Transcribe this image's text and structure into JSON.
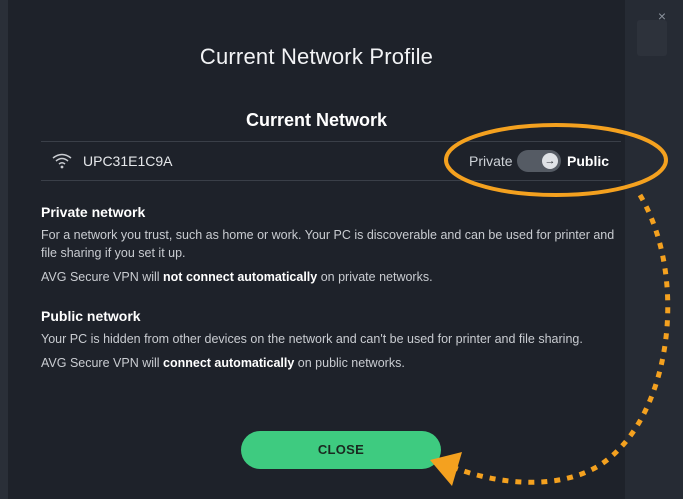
{
  "dialog": {
    "title": "Current Network Profile",
    "section_title": "Current Network",
    "close_x": "×"
  },
  "network": {
    "name": "UPC31E1C9A",
    "toggle_left_label": "Private",
    "toggle_right_label": "Public",
    "toggle_state": "Public",
    "toggle_knob_glyph": "→"
  },
  "private_info": {
    "heading": "Private network",
    "description": "For a network you trust, such as home or work. Your PC is discoverable and can be used for printer and file sharing if you set it up.",
    "vpn_prefix": "AVG Secure VPN will ",
    "vpn_bold": "not connect automatically",
    "vpn_suffix": " on private networks."
  },
  "public_info": {
    "heading": "Public network",
    "description": "Your PC is hidden from other devices on the network and can't be used for printer and file sharing.",
    "vpn_prefix": "AVG Secure VPN will ",
    "vpn_bold": "connect automatically",
    "vpn_suffix": " on public networks."
  },
  "buttons": {
    "close_label": "CLOSE"
  },
  "colors": {
    "background": "#1e222a",
    "accent_green": "#3ecb80",
    "annotation_orange": "#f4a11f",
    "toggle_track": "#555b64"
  },
  "icons": {
    "wifi": "wifi-icon",
    "arrow": "arrow-right-icon",
    "close": "close-icon"
  }
}
